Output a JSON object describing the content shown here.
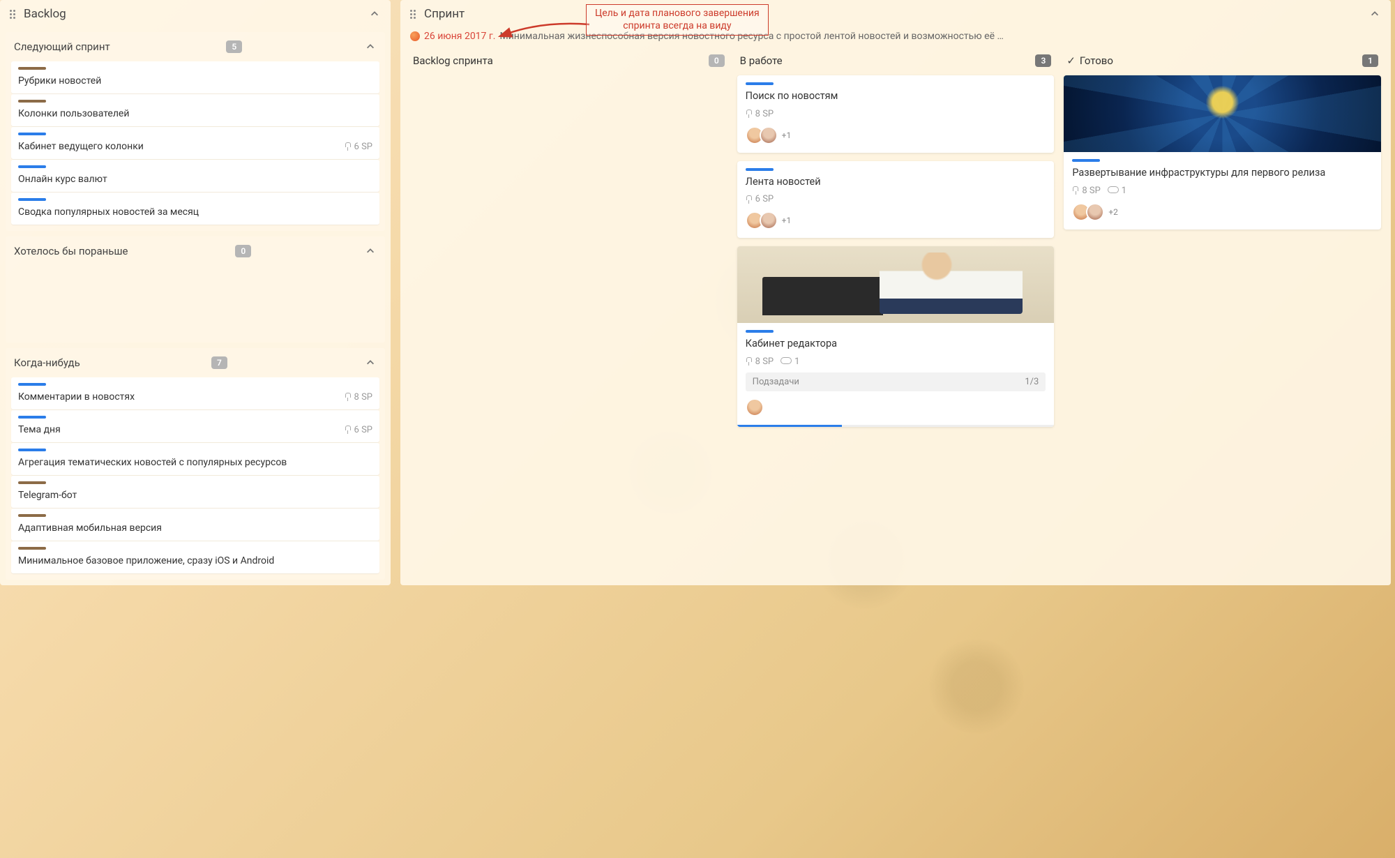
{
  "backlog": {
    "title": "Backlog",
    "sections": [
      {
        "title": "Следующий спринт",
        "count": "5",
        "cards": [
          {
            "stripe": "brown",
            "title": "Рубрики новостей",
            "sp": ""
          },
          {
            "stripe": "brown",
            "title": "Колонки пользователей",
            "sp": ""
          },
          {
            "stripe": "blue",
            "title": "Кабинет ведущего колонки",
            "sp": "6 SP"
          },
          {
            "stripe": "blue",
            "title": "Онлайн курс валют",
            "sp": ""
          },
          {
            "stripe": "blue",
            "title": "Сводка популярных новостей за месяц",
            "sp": ""
          }
        ]
      },
      {
        "title": "Хотелось бы пораньше",
        "count": "0",
        "cards": []
      },
      {
        "title": "Когда-нибудь",
        "count": "7",
        "cards": [
          {
            "stripe": "blue",
            "title": "Комментарии в новостях",
            "sp": "8 SP"
          },
          {
            "stripe": "blue",
            "title": "Тема дня",
            "sp": "6 SP"
          },
          {
            "stripe": "blue",
            "title": "Агрегация тематических новостей с популярных ресурсов",
            "sp": ""
          },
          {
            "stripe": "brown",
            "title": "Telegram-бот",
            "sp": ""
          },
          {
            "stripe": "brown",
            "title": "Адаптивная мобильная версия",
            "sp": ""
          },
          {
            "stripe": "brown",
            "title": "Минимальное базовое приложение, сразу iOS и Android",
            "sp": ""
          }
        ]
      }
    ]
  },
  "sprint": {
    "title": "Спринт",
    "goal_date": "26 июня 2017 г.",
    "goal_text": "Минимальная жизнеспособная версия новостного ресурса с простой лентой новостей и возможностью её …",
    "columns": [
      {
        "title": "Backlog спринта",
        "count": "0",
        "tasks": []
      },
      {
        "title": "В работе",
        "count": "3",
        "tasks": [
          {
            "cover": "",
            "stripe": "blue",
            "title": "Поиск по новостям",
            "sp": "8 SP",
            "clip": "",
            "avatars": 2,
            "more": "+1",
            "subtasks": "",
            "progress": 0
          },
          {
            "cover": "",
            "stripe": "blue",
            "title": "Лента новостей",
            "sp": "6 SP",
            "clip": "",
            "avatars": 2,
            "more": "+1",
            "subtasks": "",
            "progress": 0
          },
          {
            "cover": "writer",
            "stripe": "blue",
            "title": "Кабинет редактора",
            "sp": "8 SP",
            "clip": "1",
            "avatars": 1,
            "more": "",
            "subtasks_label": "Подзадачи",
            "subtasks": "1/3",
            "progress": 33
          }
        ]
      },
      {
        "title": "Готово",
        "count": "1",
        "check": true,
        "tasks": [
          {
            "cover": "tech",
            "stripe": "blue",
            "title": "Развертывание инфраструктуры для первого релиза",
            "sp": "8 SP",
            "clip": "1",
            "avatars": 2,
            "more": "+2",
            "subtasks": "",
            "progress": 0
          }
        ]
      }
    ]
  },
  "annotation": {
    "line1": "Цель и дата планового завершения",
    "line2": "спринта всегда на виду"
  }
}
